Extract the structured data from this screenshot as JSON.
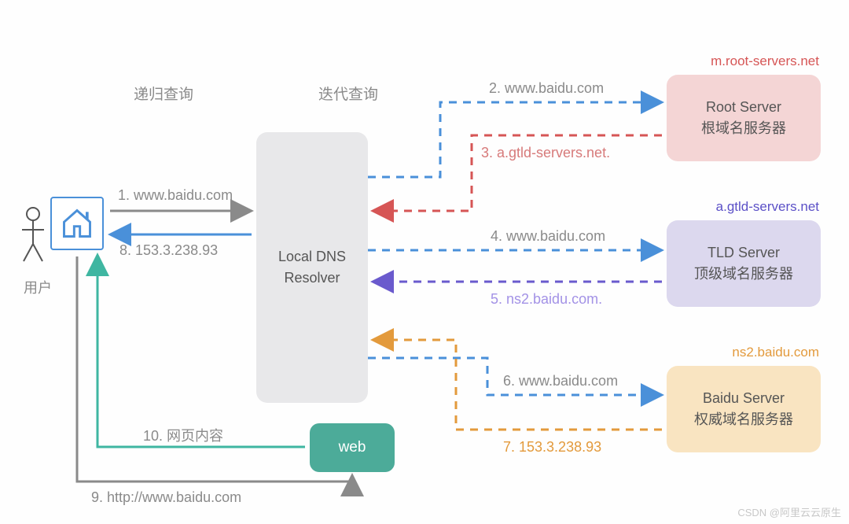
{
  "header": {
    "recursive_label": "递归查询",
    "iterative_label": "迭代查询"
  },
  "user": {
    "label": "用户"
  },
  "resolver": {
    "line1": "Local DNS",
    "line2": "Resolver"
  },
  "web": {
    "label": "web"
  },
  "servers": {
    "root": {
      "caption": "m.root-servers.net",
      "line1": "Root Server",
      "line2": "根域名服务器"
    },
    "tld": {
      "caption": "a.gtld-servers.net",
      "line1": "TLD Server",
      "line2": "顶级域名服务器"
    },
    "auth": {
      "caption": "ns2.baidu.com",
      "line1": "Baidu Server",
      "line2": "权威域名服务器"
    }
  },
  "steps": {
    "s1": "1. www.baidu.com",
    "s2": "2. www.baidu.com",
    "s3": "3.  a.gtld-servers.net.",
    "s4": "4. www.baidu.com",
    "s5": "5. ns2.baidu.com.",
    "s6": "6. www.baidu.com",
    "s7": "7. 153.3.238.93",
    "s8": "8. 153.3.238.93",
    "s9": "9. http://www.baidu.com",
    "s10": "10. 网页内容"
  },
  "watermark": "CSDN @阿里云云原生",
  "chart_data": {
    "type": "diagram",
    "title": "DNS 递归/迭代查询流程",
    "nodes": [
      {
        "id": "user",
        "label": "用户"
      },
      {
        "id": "resolver",
        "label": "Local DNS Resolver"
      },
      {
        "id": "root",
        "label": "Root Server / 根域名服务器",
        "host": "m.root-servers.net"
      },
      {
        "id": "tld",
        "label": "TLD Server / 顶级域名服务器",
        "host": "a.gtld-servers.net"
      },
      {
        "id": "auth",
        "label": "Baidu Server / 权威域名服务器",
        "host": "ns2.baidu.com"
      },
      {
        "id": "web",
        "label": "web"
      }
    ],
    "edges": [
      {
        "step": 1,
        "from": "user",
        "to": "resolver",
        "query": "www.baidu.com",
        "kind": "recursive"
      },
      {
        "step": 2,
        "from": "resolver",
        "to": "root",
        "query": "www.baidu.com",
        "kind": "iterative"
      },
      {
        "step": 3,
        "from": "root",
        "to": "resolver",
        "answer": "a.gtld-servers.net.",
        "kind": "iterative"
      },
      {
        "step": 4,
        "from": "resolver",
        "to": "tld",
        "query": "www.baidu.com",
        "kind": "iterative"
      },
      {
        "step": 5,
        "from": "tld",
        "to": "resolver",
        "answer": "ns2.baidu.com.",
        "kind": "iterative"
      },
      {
        "step": 6,
        "from": "resolver",
        "to": "auth",
        "query": "www.baidu.com",
        "kind": "iterative"
      },
      {
        "step": 7,
        "from": "auth",
        "to": "resolver",
        "answer": "153.3.238.93",
        "kind": "iterative"
      },
      {
        "step": 8,
        "from": "resolver",
        "to": "user",
        "answer": "153.3.238.93",
        "kind": "recursive"
      },
      {
        "step": 9,
        "from": "user",
        "to": "web",
        "request": "http://www.baidu.com"
      },
      {
        "step": 10,
        "from": "web",
        "to": "user",
        "response": "网页内容"
      }
    ],
    "colors": {
      "recursive_query": "#8a8a8a",
      "recursive_answer": "#4a90d9",
      "root_query": "#4a90d9",
      "root_answer": "#d65555",
      "tld_query": "#4a90d9",
      "tld_answer": "#6a5acd",
      "auth_query": "#4a90d9",
      "auth_answer": "#e39a3c",
      "http_request": "#8a8a8a",
      "http_response": "#3fb6a1"
    }
  }
}
